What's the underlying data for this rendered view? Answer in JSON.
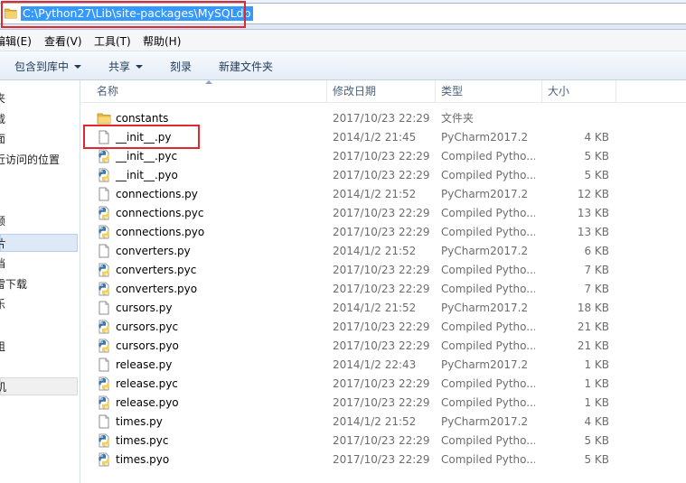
{
  "address": {
    "path": "C:\\Python27\\Lib\\site-packages\\MySQLdb",
    "icon": "folder-icon"
  },
  "menu": [
    {
      "label": "编辑(E)"
    },
    {
      "label": "查看(V)"
    },
    {
      "label": "工具(T)"
    },
    {
      "label": "帮助(H)"
    }
  ],
  "toolbar": {
    "include_in_library": "包含到库中",
    "share": "共享",
    "burn": "刻录",
    "new_folder": "新建文件夹"
  },
  "nav": [
    {
      "label": "夹"
    },
    {
      "label": "载"
    },
    {
      "label": "面"
    },
    {
      "label": "近访问的位置"
    },
    {
      "label": "频"
    },
    {
      "label": "片",
      "selected": true
    },
    {
      "label": "档"
    },
    {
      "label": "雷下载"
    },
    {
      "label": "乐"
    },
    {
      "label": "组"
    },
    {
      "label": "机"
    }
  ],
  "columns": {
    "name": "名称",
    "date": "修改日期",
    "type": "类型",
    "size": "大小"
  },
  "files": [
    {
      "name": "constants",
      "date": "2017/10/23 22:29",
      "type": "文件夹",
      "size": "",
      "icon": "folder-icon"
    },
    {
      "name": "__init__.py",
      "date": "2014/1/2 21:45",
      "type": "PyCharm2017.2",
      "size": "4 KB",
      "icon": "blank-file-icon"
    },
    {
      "name": "__init__.pyc",
      "date": "2017/10/23 22:29",
      "type": "Compiled Pytho...",
      "size": "5 KB",
      "icon": "python-file-icon"
    },
    {
      "name": "__init__.pyo",
      "date": "2017/10/23 22:29",
      "type": "Compiled Pytho...",
      "size": "5 KB",
      "icon": "python-file-icon"
    },
    {
      "name": "connections.py",
      "date": "2014/1/2 21:52",
      "type": "PyCharm2017.2",
      "size": "12 KB",
      "icon": "blank-file-icon"
    },
    {
      "name": "connections.pyc",
      "date": "2017/10/23 22:29",
      "type": "Compiled Pytho...",
      "size": "13 KB",
      "icon": "python-file-icon"
    },
    {
      "name": "connections.pyo",
      "date": "2017/10/23 22:29",
      "type": "Compiled Pytho...",
      "size": "13 KB",
      "icon": "python-file-icon"
    },
    {
      "name": "converters.py",
      "date": "2014/1/2 21:52",
      "type": "PyCharm2017.2",
      "size": "6 KB",
      "icon": "blank-file-icon"
    },
    {
      "name": "converters.pyc",
      "date": "2017/10/23 22:29",
      "type": "Compiled Pytho...",
      "size": "7 KB",
      "icon": "python-file-icon"
    },
    {
      "name": "converters.pyo",
      "date": "2017/10/23 22:29",
      "type": "Compiled Pytho...",
      "size": "7 KB",
      "icon": "python-file-icon"
    },
    {
      "name": "cursors.py",
      "date": "2014/1/2 21:52",
      "type": "PyCharm2017.2",
      "size": "18 KB",
      "icon": "blank-file-icon"
    },
    {
      "name": "cursors.pyc",
      "date": "2017/10/23 22:29",
      "type": "Compiled Pytho...",
      "size": "21 KB",
      "icon": "python-file-icon"
    },
    {
      "name": "cursors.pyo",
      "date": "2017/10/23 22:29",
      "type": "Compiled Pytho...",
      "size": "21 KB",
      "icon": "python-file-icon"
    },
    {
      "name": "release.py",
      "date": "2014/1/2 22:43",
      "type": "PyCharm2017.2",
      "size": "1 KB",
      "icon": "blank-file-icon"
    },
    {
      "name": "release.pyc",
      "date": "2017/10/23 22:29",
      "type": "Compiled Pytho...",
      "size": "1 KB",
      "icon": "python-file-icon"
    },
    {
      "name": "release.pyo",
      "date": "2017/10/23 22:29",
      "type": "Compiled Pytho...",
      "size": "1 KB",
      "icon": "python-file-icon"
    },
    {
      "name": "times.py",
      "date": "2014/1/2 21:52",
      "type": "PyCharm2017.2",
      "size": "4 KB",
      "icon": "blank-file-icon"
    },
    {
      "name": "times.pyc",
      "date": "2017/10/23 22:29",
      "type": "Compiled Pytho...",
      "size": "5 KB",
      "icon": "python-file-icon"
    },
    {
      "name": "times.pyo",
      "date": "2017/10/23 22:29",
      "type": "Compiled Pytho...",
      "size": "5 KB",
      "icon": "python-file-icon"
    }
  ],
  "colors": {
    "highlight_box": "#e0282e",
    "address_selection": "#3399ff",
    "folder": "#e8b840",
    "python_blue": "#3b75a8",
    "python_yellow": "#f5d04a"
  }
}
